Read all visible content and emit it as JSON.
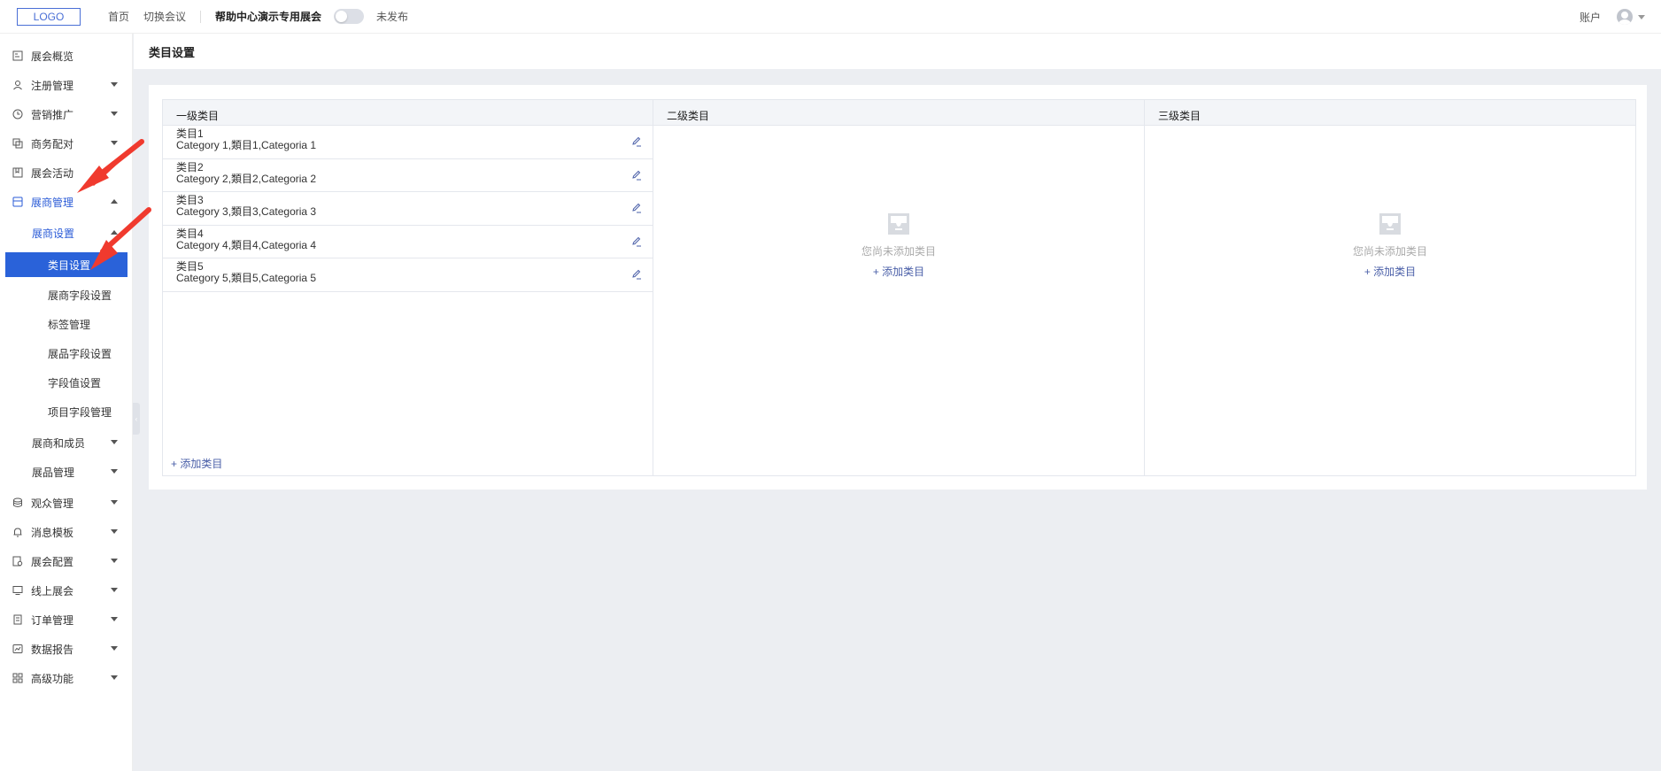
{
  "topbar": {
    "logo": "LOGO",
    "nav": [
      "首页",
      "切换会议"
    ],
    "expo_name": "帮助中心演示专用展会",
    "publish_status": "未发布",
    "account": "账户"
  },
  "sidebar": {
    "items": [
      {
        "label": "展会概览",
        "icon": "overview-icon"
      },
      {
        "label": "注册管理",
        "icon": "user-icon"
      },
      {
        "label": "营销推广",
        "icon": "clock-icon"
      },
      {
        "label": "商务配对",
        "icon": "copy-icon"
      },
      {
        "label": "展会活动",
        "icon": "bookmark-icon"
      },
      {
        "label": "展商管理",
        "icon": "store-icon"
      },
      {
        "label": "展商设置"
      },
      {
        "label": "类目设置"
      },
      {
        "label": "展商字段设置"
      },
      {
        "label": "标签管理"
      },
      {
        "label": "展品字段设置"
      },
      {
        "label": "字段值设置"
      },
      {
        "label": "项目字段管理"
      },
      {
        "label": "展商和成员"
      },
      {
        "label": "展品管理"
      },
      {
        "label": "观众管理",
        "icon": "database-icon"
      },
      {
        "label": "消息模板",
        "icon": "bell-icon"
      },
      {
        "label": "展会配置",
        "icon": "settings-doc-icon"
      },
      {
        "label": "线上展会",
        "icon": "monitor-icon"
      },
      {
        "label": "订单管理",
        "icon": "order-icon"
      },
      {
        "label": "数据报告",
        "icon": "chart-icon"
      },
      {
        "label": "高级功能",
        "icon": "grid-icon"
      }
    ]
  },
  "page": {
    "title": "类目设置",
    "columns": [
      "一级类目",
      "二级类目",
      "三级类目"
    ],
    "categories": [
      {
        "name": "类目1",
        "desc": "Category 1,類目1,Categoria 1"
      },
      {
        "name": "类目2",
        "desc": "Category 2,類目2,Categoria 2"
      },
      {
        "name": "类目3",
        "desc": "Category 3,類目3,Categoria 3"
      },
      {
        "name": "类目4",
        "desc": "Category 4,類目4,Categoria 4"
      },
      {
        "name": "类目5",
        "desc": "Category 5,類目5,Categoria 5"
      }
    ],
    "add_label": "+ 添加类目",
    "empty_text": "您尚未添加类目"
  },
  "colors": {
    "primary": "#2a62d9",
    "link": "#4a5fa8",
    "arrow": "#f03a2e"
  }
}
